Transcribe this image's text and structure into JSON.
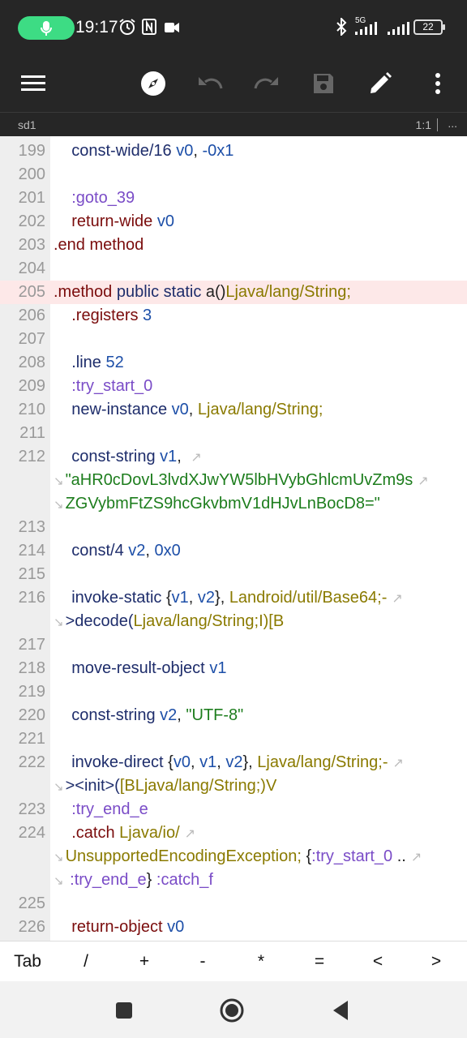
{
  "status_bar": {
    "time": "19:17",
    "network_label": "5G",
    "battery": "22",
    "icons": [
      "mic-icon",
      "alarm-icon",
      "nfc-icon",
      "video-icon",
      "bluetooth-icon",
      "signal-icon",
      "signal-icon",
      "battery-icon"
    ]
  },
  "toolbar": {
    "icons": [
      "menu-icon",
      "compass-icon",
      "undo-icon",
      "redo-icon",
      "save-icon",
      "edit-icon",
      "more-icon"
    ]
  },
  "tab": {
    "name": "sd1",
    "cursor_position": "1:1",
    "more": "..."
  },
  "code_lines": [
    {
      "n": "199",
      "hl": false,
      "tokens": [
        [
          "    ",
          "plain"
        ],
        [
          "const-wide/16",
          "op"
        ],
        [
          " ",
          "plain"
        ],
        [
          "v0",
          "reg"
        ],
        [
          ", ",
          "plain"
        ],
        [
          "-0x1",
          "num"
        ]
      ]
    },
    {
      "n": "200",
      "hl": false,
      "tokens": []
    },
    {
      "n": "201",
      "hl": false,
      "tokens": [
        [
          "    ",
          "plain"
        ],
        [
          ":goto_39",
          "lbl"
        ]
      ]
    },
    {
      "n": "202",
      "hl": false,
      "tokens": [
        [
          "    ",
          "plain"
        ],
        [
          "return-wide",
          "meth"
        ],
        [
          " ",
          "plain"
        ],
        [
          "v0",
          "reg"
        ]
      ]
    },
    {
      "n": "203",
      "hl": false,
      "tokens": [
        [
          ".end",
          "meth"
        ],
        [
          " ",
          "plain"
        ],
        [
          "method",
          "meth"
        ]
      ]
    },
    {
      "n": "204",
      "hl": false,
      "tokens": []
    },
    {
      "n": "205",
      "hl": true,
      "tokens": [
        [
          ".method",
          "meth"
        ],
        [
          " ",
          "plain"
        ],
        [
          "public",
          "kw"
        ],
        [
          " ",
          "plain"
        ],
        [
          "static",
          "kw"
        ],
        [
          " ",
          "plain"
        ],
        [
          "a()",
          "plain"
        ],
        [
          "Ljava/lang/String;",
          "type"
        ]
      ]
    },
    {
      "n": "206",
      "hl": false,
      "tokens": [
        [
          "    ",
          "plain"
        ],
        [
          ".registers",
          "meth"
        ],
        [
          " ",
          "plain"
        ],
        [
          "3",
          "num"
        ]
      ]
    },
    {
      "n": "207",
      "hl": false,
      "tokens": []
    },
    {
      "n": "208",
      "hl": false,
      "tokens": [
        [
          "    ",
          "plain"
        ],
        [
          ".line",
          "op"
        ],
        [
          " ",
          "plain"
        ],
        [
          "52",
          "num"
        ]
      ]
    },
    {
      "n": "209",
      "hl": false,
      "tokens": [
        [
          "    ",
          "plain"
        ],
        [
          ":try_start_0",
          "lbl"
        ]
      ]
    },
    {
      "n": "210",
      "hl": false,
      "tokens": [
        [
          "    ",
          "plain"
        ],
        [
          "new-instance",
          "op"
        ],
        [
          " ",
          "plain"
        ],
        [
          "v0",
          "reg"
        ],
        [
          ", ",
          "plain"
        ],
        [
          "Ljava/lang/String;",
          "type"
        ]
      ]
    },
    {
      "n": "211",
      "hl": false,
      "tokens": []
    },
    {
      "n": "212",
      "hl": false,
      "tokens": [
        [
          "    ",
          "plain"
        ],
        [
          "const-string",
          "op"
        ],
        [
          " ",
          "plain"
        ],
        [
          "v1",
          "reg"
        ],
        [
          ", ",
          "plain"
        ]
      ],
      "wrap": true
    },
    {
      "n": "",
      "hl": false,
      "cont": true,
      "tokens": [
        [
          "\"aHR0cDovL3lvdXJwYW5lbHVybGhlcmUvZm9s",
          "str"
        ]
      ],
      "wrap": true
    },
    {
      "n": "",
      "hl": false,
      "cont": true,
      "tokens": [
        [
          "ZGVybmFtZS9hcGkvbmV1dHJvLnBocD8=\"",
          "str"
        ]
      ]
    },
    {
      "n": "213",
      "hl": false,
      "tokens": []
    },
    {
      "n": "214",
      "hl": false,
      "tokens": [
        [
          "    ",
          "plain"
        ],
        [
          "const/4",
          "op"
        ],
        [
          " ",
          "plain"
        ],
        [
          "v2",
          "reg"
        ],
        [
          ", ",
          "plain"
        ],
        [
          "0x0",
          "num"
        ]
      ]
    },
    {
      "n": "215",
      "hl": false,
      "tokens": []
    },
    {
      "n": "216",
      "hl": false,
      "tokens": [
        [
          "    ",
          "plain"
        ],
        [
          "invoke-static",
          "op"
        ],
        [
          " {",
          "plain"
        ],
        [
          "v1",
          "reg"
        ],
        [
          ", ",
          "plain"
        ],
        [
          "v2",
          "reg"
        ],
        [
          "}, ",
          "plain"
        ],
        [
          "Landroid/util/Base64;-",
          "type"
        ]
      ],
      "wrap": true
    },
    {
      "n": "",
      "hl": false,
      "cont": true,
      "tokens": [
        [
          ">decode(",
          "op"
        ],
        [
          "Ljava/lang/String;I)[B",
          "type"
        ]
      ]
    },
    {
      "n": "217",
      "hl": false,
      "tokens": []
    },
    {
      "n": "218",
      "hl": false,
      "tokens": [
        [
          "    ",
          "plain"
        ],
        [
          "move-result-object",
          "op"
        ],
        [
          " ",
          "plain"
        ],
        [
          "v1",
          "reg"
        ]
      ]
    },
    {
      "n": "219",
      "hl": false,
      "tokens": []
    },
    {
      "n": "220",
      "hl": false,
      "tokens": [
        [
          "    ",
          "plain"
        ],
        [
          "const-string",
          "op"
        ],
        [
          " ",
          "plain"
        ],
        [
          "v2",
          "reg"
        ],
        [
          ", ",
          "plain"
        ],
        [
          "\"UTF-8\"",
          "str"
        ]
      ]
    },
    {
      "n": "221",
      "hl": false,
      "tokens": []
    },
    {
      "n": "222",
      "hl": false,
      "tokens": [
        [
          "    ",
          "plain"
        ],
        [
          "invoke-direct",
          "op"
        ],
        [
          " {",
          "plain"
        ],
        [
          "v0",
          "reg"
        ],
        [
          ", ",
          "plain"
        ],
        [
          "v1",
          "reg"
        ],
        [
          ", ",
          "plain"
        ],
        [
          "v2",
          "reg"
        ],
        [
          "}, ",
          "plain"
        ],
        [
          "Ljava/lang/String;-",
          "type"
        ]
      ],
      "wrap": true
    },
    {
      "n": "",
      "hl": false,
      "cont": true,
      "tokens": [
        [
          "><init>(",
          "op"
        ],
        [
          "[BLjava/lang/String;)V",
          "type"
        ]
      ]
    },
    {
      "n": "223",
      "hl": false,
      "tokens": [
        [
          "    ",
          "plain"
        ],
        [
          ":try_end_e",
          "lbl"
        ]
      ]
    },
    {
      "n": "224",
      "hl": false,
      "tokens": [
        [
          "    ",
          "plain"
        ],
        [
          ".catch",
          "meth"
        ],
        [
          " ",
          "plain"
        ],
        [
          "Ljava/io/",
          "type"
        ]
      ],
      "wrap": true
    },
    {
      "n": "",
      "hl": false,
      "cont": true,
      "tokens": [
        [
          "UnsupportedEncodingException;",
          "type"
        ],
        [
          " {",
          "plain"
        ],
        [
          ":try_start_0",
          "lbl"
        ],
        [
          " ..",
          "plain"
        ]
      ],
      "wrap": true
    },
    {
      "n": "",
      "hl": false,
      "cont": true,
      "tokens": [
        [
          " ",
          "plain"
        ],
        [
          ":try_end_e",
          "lbl"
        ],
        [
          "} ",
          "plain"
        ],
        [
          ":catch_f",
          "lbl"
        ]
      ]
    },
    {
      "n": "225",
      "hl": false,
      "tokens": []
    },
    {
      "n": "226",
      "hl": false,
      "tokens": [
        [
          "    ",
          "plain"
        ],
        [
          "return-object",
          "meth"
        ],
        [
          " ",
          "plain"
        ],
        [
          "v0",
          "reg"
        ]
      ]
    }
  ],
  "extra_keys": [
    "Tab",
    "/",
    "+",
    "-",
    "*",
    "=",
    "<",
    ">"
  ],
  "nav": {
    "icons": [
      "recents-icon",
      "home-icon",
      "back-icon"
    ]
  }
}
